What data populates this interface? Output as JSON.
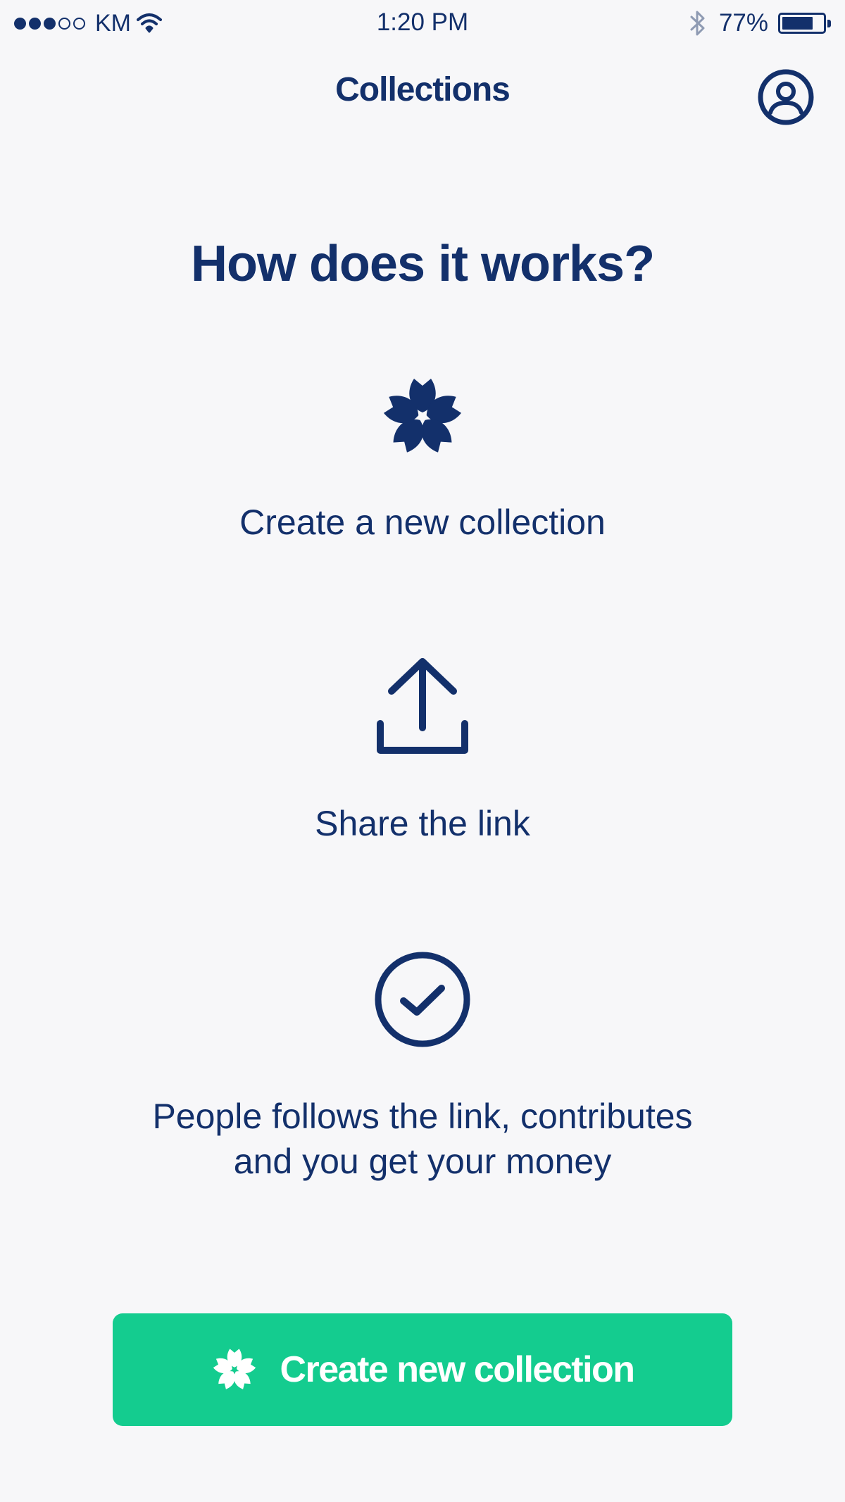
{
  "status_bar": {
    "carrier": "KM",
    "time": "1:20 PM",
    "battery_percent": "77%",
    "battery_level": 0.77,
    "signal_strength": 3,
    "signal_max": 5
  },
  "nav": {
    "title": "Collections",
    "profile_icon": "user-circle-icon"
  },
  "main": {
    "headline": "How does it works?",
    "steps": [
      {
        "icon": "flower-icon",
        "text": "Create a new collection"
      },
      {
        "icon": "share-upload-icon",
        "text": "Share the link"
      },
      {
        "icon": "check-circle-icon",
        "text": "People follows the link, contributes\nand you get your money"
      }
    ]
  },
  "cta": {
    "label": "Create new collection",
    "icon": "flower-icon"
  },
  "colors": {
    "primary": "#13306b",
    "accent": "#14cc8f",
    "background": "#f7f7f9",
    "muted": "#8f9bb3"
  }
}
